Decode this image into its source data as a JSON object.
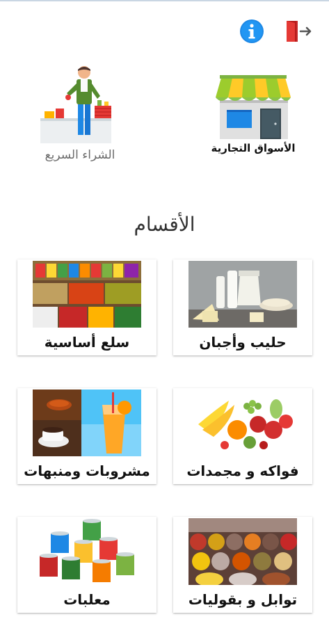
{
  "header": {
    "exit_icon": "exit-door-icon",
    "info_icon": "info-icon",
    "info_color": "#1e88e5",
    "exit_color": "#e53935"
  },
  "shortcuts": {
    "markets_label": "الأسواق التجارية",
    "quick_buy_label": "الشراء السريع"
  },
  "sections": {
    "title": "الأقسام"
  },
  "categories": [
    {
      "label": "حليب وأجبان",
      "icon": "dairy-image"
    },
    {
      "label": "سلع أساسية",
      "icon": "groceries-image"
    },
    {
      "label": "فواكه و مجمدات",
      "icon": "fruits-image"
    },
    {
      "label": "مشروبات ومنبهات",
      "icon": "drinks-image"
    },
    {
      "label": "توابل و بقوليات",
      "icon": "spices-image"
    },
    {
      "label": "معلبات",
      "icon": "canned-goods-image"
    }
  ]
}
